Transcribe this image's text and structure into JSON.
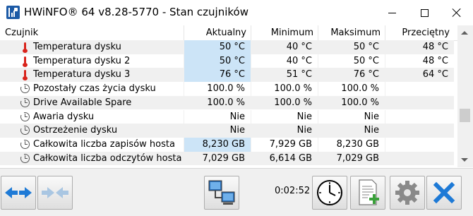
{
  "window": {
    "title": "HWiNFO® 64 v8.28-5770 - Stan czujników"
  },
  "table": {
    "headers": [
      "Czujnik",
      "Aktualny",
      "Minimum",
      "Maksimum",
      "Przeciętny"
    ],
    "rows": [
      {
        "name": "Temperatura dysku",
        "icon": "thermometer-icon",
        "current": "50 °C",
        "min": "40 °C",
        "max": "50 °C",
        "avg": "48 °C"
      },
      {
        "name": "Temperatura dysku 2",
        "icon": "thermometer-icon",
        "current": "50 °C",
        "min": "40 °C",
        "max": "50 °C",
        "avg": "48 °C"
      },
      {
        "name": "Temperatura dysku 3",
        "icon": "thermometer-icon",
        "current": "76 °C",
        "min": "51 °C",
        "max": "76 °C",
        "avg": "64 °C"
      },
      {
        "name": "Pozostały czas życia dysku",
        "icon": "clock-icon",
        "current": "100.0 %",
        "min": "100.0 %",
        "max": "100.0 %",
        "avg": ""
      },
      {
        "name": "Drive Available Spare",
        "icon": "clock-icon",
        "current": "100.0 %",
        "min": "100.0 %",
        "max": "100.0 %",
        "avg": ""
      },
      {
        "name": "Awaria dysku",
        "icon": "clock-icon",
        "current": "Nie",
        "min": "Nie",
        "max": "Nie",
        "avg": ""
      },
      {
        "name": "Ostrzeżenie dysku",
        "icon": "clock-icon",
        "current": "Nie",
        "min": "Nie",
        "max": "Nie",
        "avg": ""
      },
      {
        "name": "Całkowita liczba zapisów hosta",
        "icon": "clock-icon",
        "current": "8,230 GB",
        "min": "7,929 GB",
        "max": "8,230 GB",
        "avg": ""
      },
      {
        "name": "Całkowita liczba odczytów hosta",
        "icon": "clock-icon",
        "current": "7,029 GB",
        "min": "6,614 GB",
        "max": "7,029 GB",
        "avg": ""
      }
    ]
  },
  "toolbar": {
    "timer": "0:02:52"
  },
  "colors": {
    "accent": "#1e7ad6",
    "highlight": "#cce4f7",
    "close_x": "#1e7ad6"
  }
}
